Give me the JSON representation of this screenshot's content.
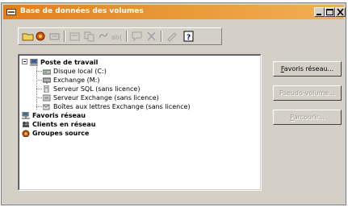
{
  "window": {
    "title": "Base de données des volumes",
    "controls": [
      "minimize",
      "maximize",
      "close"
    ]
  },
  "toolbar": {
    "icons": [
      "open-folder-icon",
      "new-volume-icon",
      "server-icon",
      "properties-icon",
      "copy-icon",
      "link-icon",
      "rename-icon",
      "comment-icon",
      "delete-icon",
      "edit-icon",
      "help-icon"
    ]
  },
  "tree": {
    "root": {
      "label": "Poste de travail",
      "expanded": true
    },
    "children": [
      {
        "label": "Disque local (C:)",
        "icon": "local-disk-icon"
      },
      {
        "label": "Exchange (M:)",
        "icon": "network-drive-icon"
      },
      {
        "label": "Serveur SQL (sans licence)",
        "icon": "sql-server-icon"
      },
      {
        "label": "Serveur Exchange (sans licence)",
        "icon": "exchange-server-icon"
      },
      {
        "label": "Boîtes aux lettres Exchange (sans licence)",
        "icon": "mailbox-icon"
      }
    ],
    "top_level": [
      {
        "label": "Favoris réseau",
        "icon": "network-favorites-icon"
      },
      {
        "label": "Clients en réseau",
        "icon": "network-clients-icon"
      },
      {
        "label": "Groupes source",
        "icon": "source-groups-icon"
      }
    ]
  },
  "buttons": {
    "favoris": {
      "mnemonic": "F",
      "rest": "avoris réseau...",
      "enabled": true
    },
    "pseudo": {
      "label": "Pseudo-volume...",
      "enabled": false
    },
    "parcourir": {
      "mnemonic": "P",
      "rest": "arcourir...",
      "enabled": false
    }
  },
  "colors": {
    "titlebar_start": "#e0801c",
    "titlebar_end": "#f2b054",
    "face": "#d4d0c8"
  }
}
